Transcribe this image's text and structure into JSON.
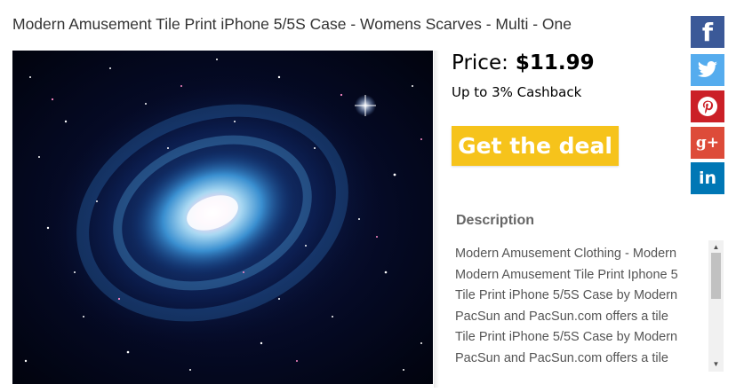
{
  "product": {
    "title": "Modern Amusement Tile Print iPhone 5/5S Case - Womens Scarves - Multi - One",
    "price_label": "Price:",
    "price": "$11.99",
    "cashback": "Up to 3% Cashback",
    "deal_button": "Get the deal",
    "image_icon": "galaxy-image"
  },
  "share": {
    "facebook": {
      "label": "f",
      "color": "#3b5998"
    },
    "twitter": {
      "icon": "twitter-bird-icon",
      "color": "#55acee"
    },
    "pinterest": {
      "icon": "pinterest-icon",
      "color": "#cb2027"
    },
    "googleplus": {
      "label": "g+",
      "color": "#dd4b39"
    },
    "linkedin": {
      "label": "in",
      "color": "#0077b5"
    }
  },
  "description": {
    "heading": "Description",
    "text": "Modern Amusement Clothing - Modern\nModern Amusement Tile Print Iphone 5\nTile Print iPhone 5/5S Case by Modern\nPacSun and PacSun.com offers a tile\nTile Print iPhone 5/5S Case by Modern\nPacSun and PacSun.com offers a tile"
  },
  "colors": {
    "deal_button": "#f6c31b",
    "description_heading": "#666666"
  }
}
